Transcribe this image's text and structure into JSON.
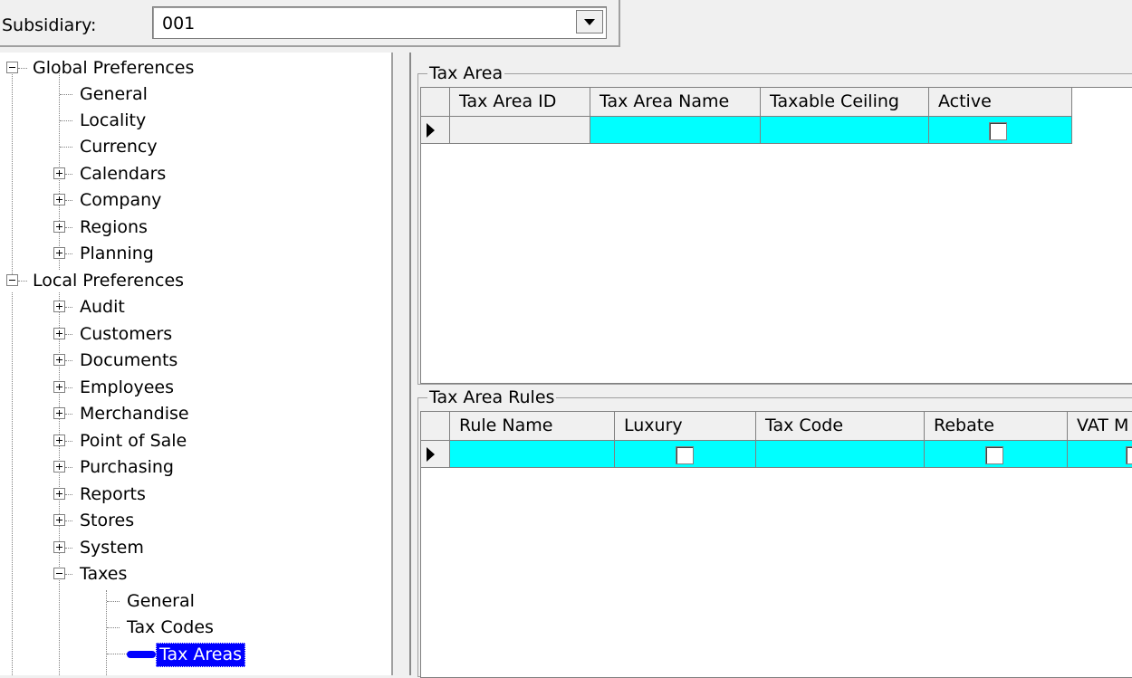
{
  "subsidiary": {
    "label": "Subsidiary:",
    "value": "001"
  },
  "tree": {
    "global_preferences": "Global Preferences",
    "general": "General",
    "locality": "Locality",
    "currency": "Currency",
    "calendars": "Calendars",
    "company": "Company",
    "regions": "Regions",
    "planning": "Planning",
    "local_preferences": "Local Preferences",
    "audit": "Audit",
    "customers": "Customers",
    "documents": "Documents",
    "employees": "Employees",
    "merchandise": "Merchandise",
    "point_of_sale": "Point of Sale",
    "purchasing": "Purchasing",
    "reports": "Reports",
    "stores": "Stores",
    "system": "System",
    "taxes": "Taxes",
    "taxes_general": "General",
    "tax_codes": "Tax Codes",
    "tax_areas": "Tax Areas"
  },
  "tax_area": {
    "title": "Tax Area",
    "columns": [
      "Tax Area ID",
      "Tax Area Name",
      "Taxable Ceiling",
      "Active"
    ],
    "row": {
      "tax_area_id": "",
      "tax_area_name": "",
      "taxable_ceiling": "",
      "active": false
    }
  },
  "tax_area_rules": {
    "title": "Tax Area Rules",
    "columns": [
      "Rule Name",
      "Luxury",
      "Tax Code",
      "Rebate",
      "VAT M"
    ],
    "row": {
      "rule_name": "",
      "luxury": false,
      "tax_code": "",
      "rebate": false,
      "vat": false
    }
  },
  "colors": {
    "grid_row": "#00ffff",
    "selection": "#0000ff",
    "panel": "#f0f0f0"
  }
}
